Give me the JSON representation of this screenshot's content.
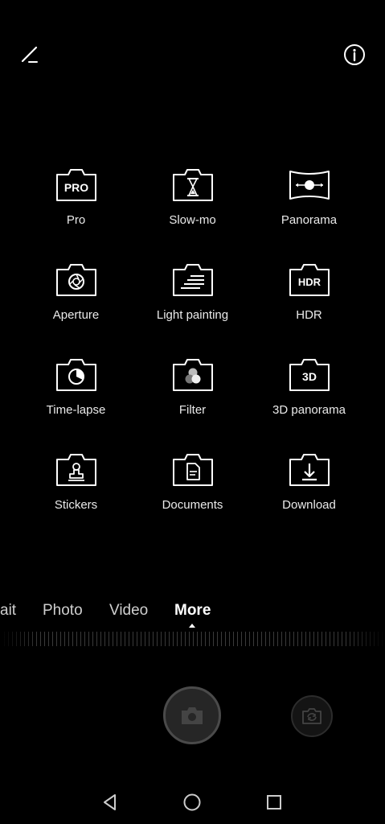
{
  "top_bar": {
    "edit_icon": "edit-icon",
    "info_icon": "info-icon"
  },
  "modes": [
    {
      "label": "Pro",
      "icon": "pro-icon",
      "icon_text": "PRO"
    },
    {
      "label": "Slow-mo",
      "icon": "hourglass-icon"
    },
    {
      "label": "Panorama",
      "icon": "panorama-icon"
    },
    {
      "label": "Aperture",
      "icon": "aperture-icon"
    },
    {
      "label": "Light painting",
      "icon": "light-painting-icon"
    },
    {
      "label": "HDR",
      "icon": "hdr-icon",
      "icon_text": "HDR"
    },
    {
      "label": "Time-lapse",
      "icon": "timelapse-icon"
    },
    {
      "label": "Filter",
      "icon": "filter-icon"
    },
    {
      "label": "3D panorama",
      "icon": "3d-panorama-icon",
      "icon_text": "3D"
    },
    {
      "label": "Stickers",
      "icon": "stickers-icon"
    },
    {
      "label": "Documents",
      "icon": "documents-icon"
    },
    {
      "label": "Download",
      "icon": "download-icon"
    }
  ],
  "tabs": [
    {
      "label": "ait"
    },
    {
      "label": "Photo"
    },
    {
      "label": "Video"
    },
    {
      "label": "More",
      "active": true
    }
  ],
  "colors": {
    "background": "#000000",
    "text": "#ffffff",
    "shutter": "#262626"
  }
}
